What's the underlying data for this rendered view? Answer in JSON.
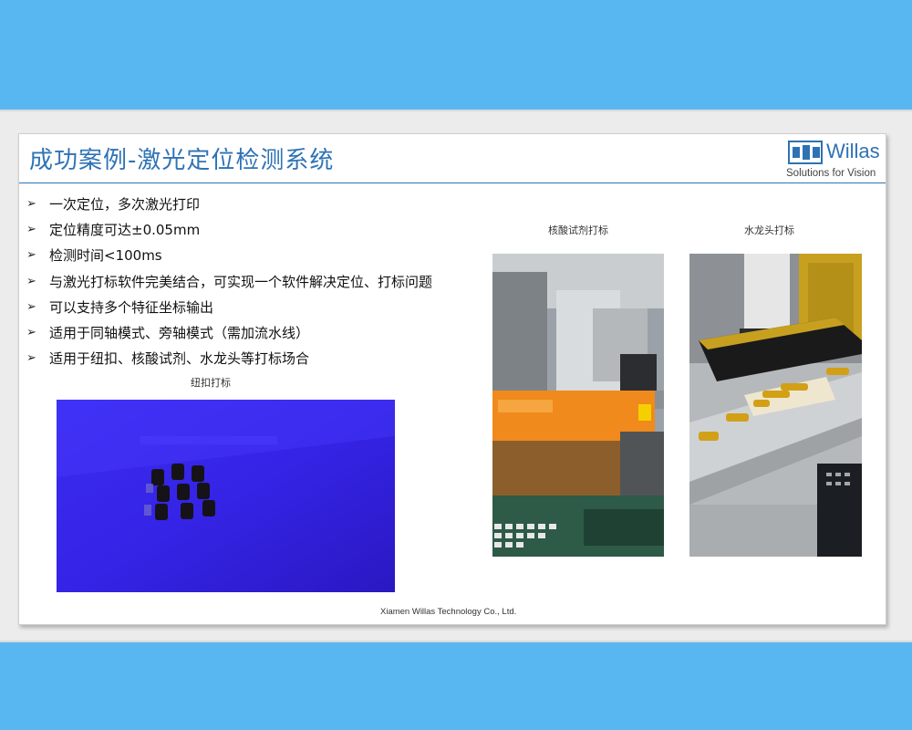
{
  "slide": {
    "title": "成功案例-激光定位检测系统",
    "logo": {
      "name": "Willas",
      "tagline": "Solutions for Vision"
    },
    "bullets": [
      "一次定位，多次激光打印",
      "定位精度可达±0.05mm",
      "检测时间<100ms",
      "与激光打标软件完美结合，可实现一个软件解决定位、打标问题",
      "可以支持多个特征坐标输出",
      "适用于同轴模式、旁轴模式（需加流水线）",
      "适用于纽扣、核酸试剂、水龙头等打标场合"
    ],
    "bullet_marker": "➢",
    "photos": {
      "button": {
        "caption": "纽扣打标"
      },
      "reagent": {
        "caption": "核酸试剂打标"
      },
      "faucet": {
        "caption": "水龙头打标"
      }
    },
    "footer": "Xiamen Willas Technology Co., Ltd."
  },
  "colors": {
    "background": "#58b6f0",
    "title": "#2f73b5",
    "brand": "#2e72b4"
  }
}
